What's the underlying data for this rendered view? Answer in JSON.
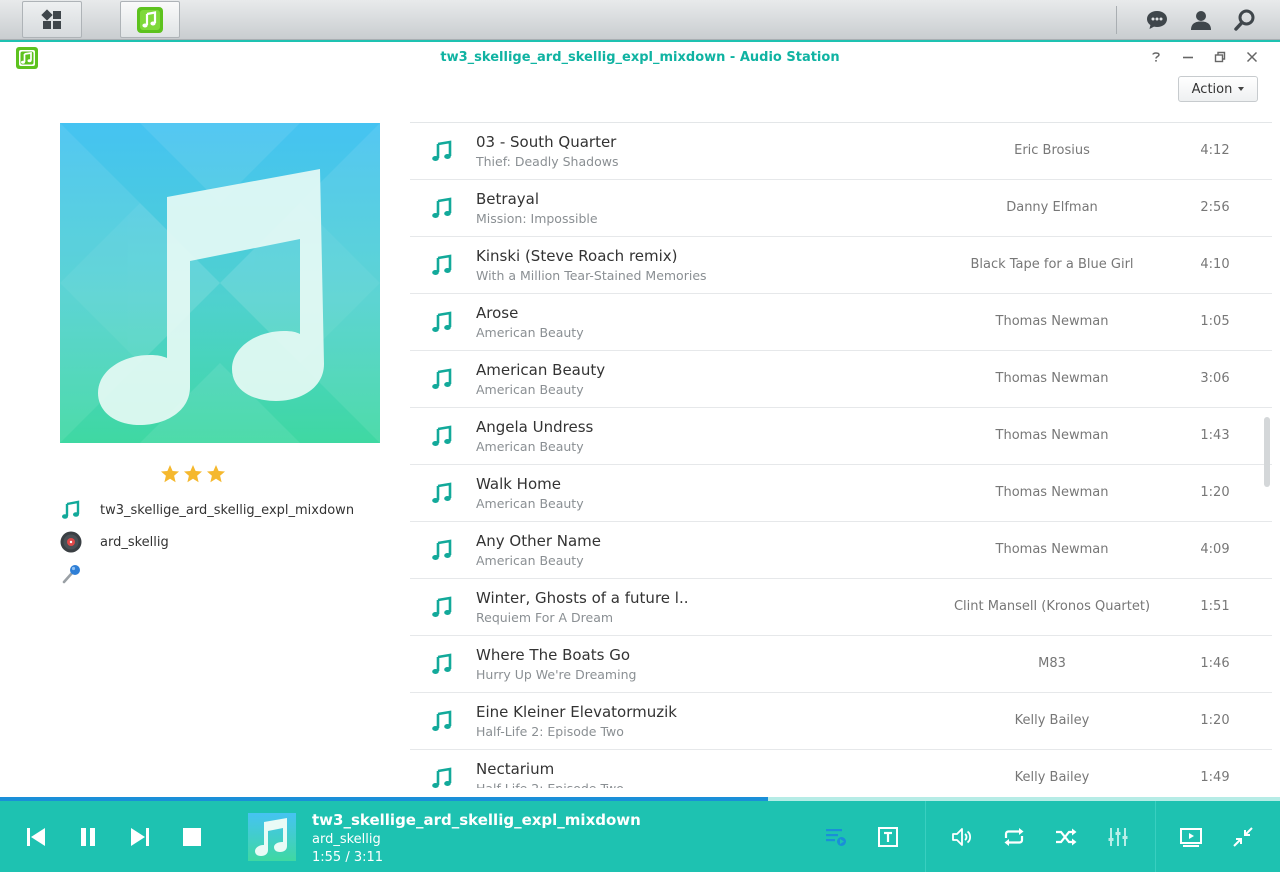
{
  "window": {
    "title": "tw3_skellige_ard_skellig_expl_mixdown - Audio Station",
    "action_label": "Action"
  },
  "now_playing": {
    "title": "tw3_skellige_ard_skellig_expl_mixdown",
    "album": "ard_skellig",
    "artist": "",
    "rating": 3,
    "time": "1:55 / 3:11",
    "progress": 0.6
  },
  "tracks": [
    {
      "title": "03 - South Quarter",
      "album": "Thief: Deadly Shadows",
      "artist": "Eric Brosius",
      "duration": "4:12"
    },
    {
      "title": "Betrayal",
      "album": "Mission: Impossible",
      "artist": "Danny Elfman",
      "duration": "2:56"
    },
    {
      "title": "Kinski (Steve Roach remix)",
      "album": "With a Million Tear-Stained Memories",
      "artist": "Black Tape for a Blue Girl",
      "duration": "4:10"
    },
    {
      "title": "Arose",
      "album": "American Beauty",
      "artist": "Thomas Newman",
      "duration": "1:05"
    },
    {
      "title": "American Beauty",
      "album": "American Beauty",
      "artist": "Thomas Newman",
      "duration": "3:06"
    },
    {
      "title": "Angela Undress",
      "album": "American Beauty",
      "artist": "Thomas Newman",
      "duration": "1:43"
    },
    {
      "title": "Walk Home",
      "album": "American Beauty",
      "artist": "Thomas Newman",
      "duration": "1:20"
    },
    {
      "title": "Any Other Name",
      "album": "American Beauty",
      "artist": "Thomas Newman",
      "duration": "4:09"
    },
    {
      "title": "Winter, Ghosts of a future l..",
      "album": "Requiem For A Dream",
      "artist": "Clint Mansell (Kronos Quartet)",
      "duration": "1:51"
    },
    {
      "title": "Where The Boats Go",
      "album": "Hurry Up We're Dreaming",
      "artist": "M83",
      "duration": "1:46"
    },
    {
      "title": "Eine Kleiner Elevatormuzik",
      "album": "Half-Life 2: Episode Two",
      "artist": "Kelly Bailey",
      "duration": "1:20"
    },
    {
      "title": "Nectarium",
      "album": "Half-Life 2: Episode Two",
      "artist": "Kelly Bailey",
      "duration": "1:49"
    }
  ],
  "colors": {
    "accent": "#1ec2b1",
    "title_text": "#10b3a2",
    "progress": "#1a8fd8",
    "star": "#f5b82e",
    "icon_active": "#1a8fd8"
  },
  "icons": {
    "taskbar": [
      "main-menu-icon",
      "audio-station-icon",
      "chat-icon",
      "user-icon",
      "search-icon"
    ],
    "window": [
      "help-icon",
      "minimize-icon",
      "restore-icon",
      "close-icon"
    ],
    "player": [
      "previous-icon",
      "pause-icon",
      "next-icon",
      "stop-icon",
      "playlist-icon",
      "lyrics-icon",
      "volume-icon",
      "repeat-icon",
      "shuffle-icon",
      "equalizer-icon",
      "video-output-icon",
      "mini-player-icon"
    ]
  }
}
